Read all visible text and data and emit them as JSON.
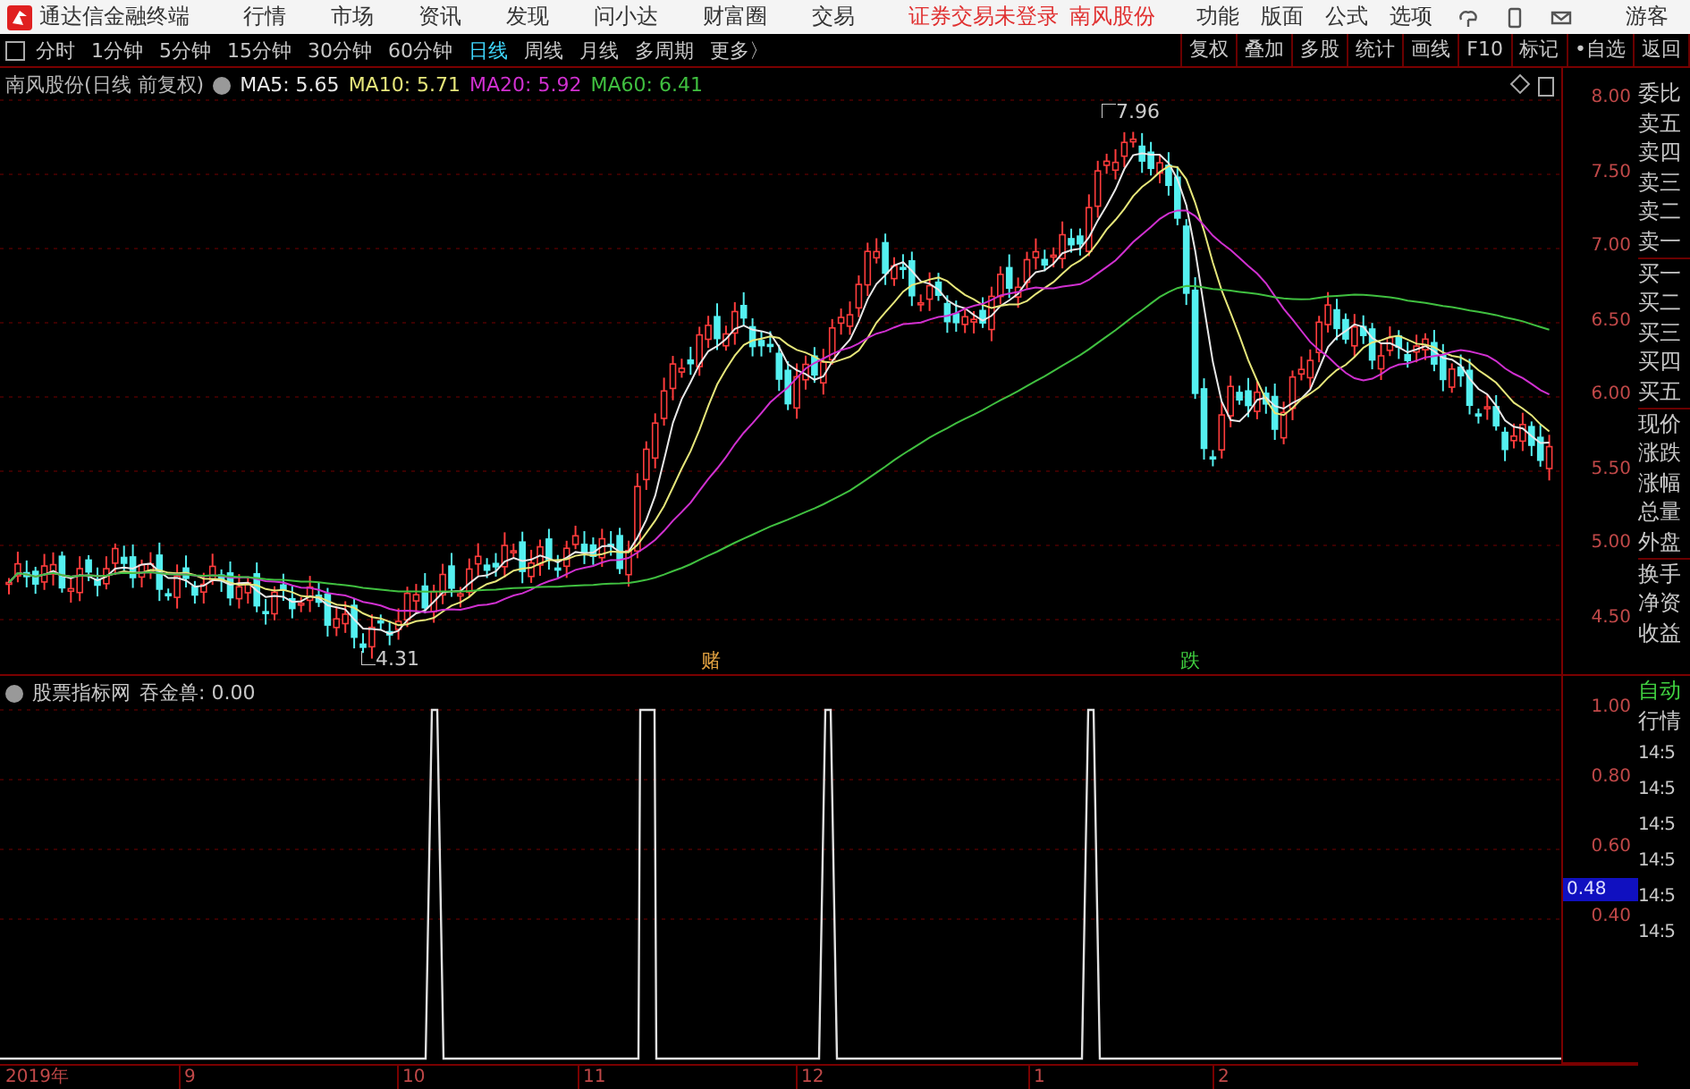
{
  "menubar": {
    "app_title": "通达信金融终端",
    "menus": [
      "行情",
      "市场",
      "资讯",
      "发现",
      "问小达",
      "财富圈",
      "交易"
    ],
    "login_status": "证券交易未登录",
    "stock": "南风股份",
    "functions": [
      "功能",
      "版面",
      "公式",
      "选项"
    ],
    "user": "游客"
  },
  "toolbar": {
    "periods": [
      {
        "label": "分时",
        "selected": false
      },
      {
        "label": "1分钟",
        "selected": false
      },
      {
        "label": "5分钟",
        "selected": false
      },
      {
        "label": "15分钟",
        "selected": false
      },
      {
        "label": "30分钟",
        "selected": false
      },
      {
        "label": "60分钟",
        "selected": false
      },
      {
        "label": "日线",
        "selected": true
      },
      {
        "label": "周线",
        "selected": false
      },
      {
        "label": "月线",
        "selected": false
      },
      {
        "label": "多周期",
        "selected": false
      },
      {
        "label": "更多〉",
        "selected": false
      }
    ],
    "tools": [
      "复权",
      "叠加",
      "多股",
      "统计",
      "画线",
      "F10",
      "标记",
      "•自选",
      "返回"
    ]
  },
  "chart": {
    "title": "南风股份(日线 前复权)",
    "averages": [
      {
        "label": "MA5: 5.65",
        "color": "#e8e8e8"
      },
      {
        "label": "MA10: 5.71",
        "color": "#e6e67a"
      },
      {
        "label": "MA20: 5.92",
        "color": "#d030d0"
      },
      {
        "label": "MA60: 6.41",
        "color": "#40c040"
      }
    ],
    "price_ticks": [
      "8.00",
      "7.50",
      "7.00",
      "6.50",
      "6.00",
      "5.50",
      "5.00",
      "4.50"
    ],
    "annotations": [
      {
        "text": "7.96",
        "kind": "high"
      },
      {
        "text": "4.31",
        "kind": "low"
      },
      {
        "text": "赌",
        "kind": "up"
      },
      {
        "text": "跌",
        "kind": "down"
      }
    ]
  },
  "indicator": {
    "source": "股票指标网",
    "reading": "吞金兽: 0.00",
    "ticks": [
      "1.00",
      "0.80",
      "0.60",
      "0.40"
    ],
    "current": "0.48"
  },
  "quote_panel": {
    "fields": [
      "委比",
      "卖五",
      "卖四",
      "卖三",
      "卖二",
      "卖一",
      "买一",
      "买二",
      "买三",
      "买四",
      "买五",
      "现价",
      "涨跌",
      "涨幅",
      "总量",
      "外盘",
      "换手",
      "净资",
      "收益"
    ],
    "mode": [
      "自动",
      "行情"
    ],
    "times": [
      "14:5",
      "14:5",
      "14:5",
      "14:5",
      "14:5",
      "14:5"
    ]
  },
  "time_axis": [
    "2019年",
    "9",
    "10",
    "11",
    "12",
    "1",
    "2"
  ]
}
